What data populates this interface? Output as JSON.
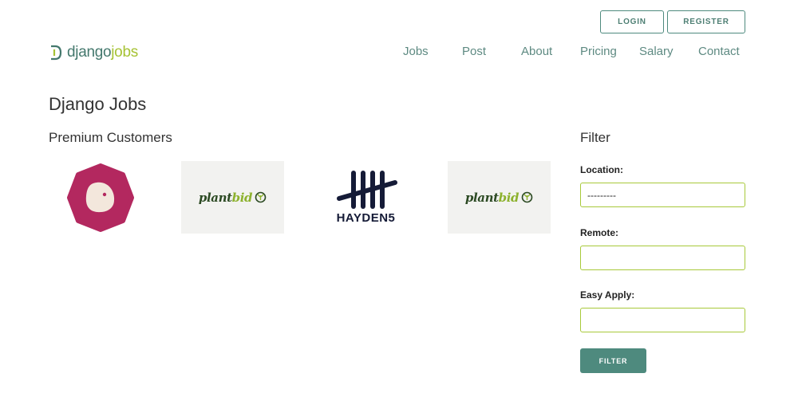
{
  "header": {
    "logo": {
      "part1": "django",
      "part2": "jobs"
    },
    "auth": {
      "login": "LOGIN",
      "register": "REGISTER"
    },
    "nav": [
      "Jobs",
      "Post",
      "About",
      "Pricing",
      "Salary",
      "Contact"
    ]
  },
  "main": {
    "title": "Django Jobs",
    "premium": {
      "heading": "Premium Customers",
      "customers": [
        {
          "name": "octagon-logo",
          "icon": "pink-octagon-blob"
        },
        {
          "name": "plantbid",
          "wordmark_1": "plant",
          "wordmark_2": "bid"
        },
        {
          "name": "hayden5",
          "wordmark": "HAYDEN5"
        },
        {
          "name": "plantbid",
          "wordmark_1": "plant",
          "wordmark_2": "bid"
        }
      ]
    }
  },
  "filter": {
    "title": "Filter",
    "location": {
      "label": "Location:",
      "value": "---------"
    },
    "remote": {
      "label": "Remote:",
      "value": ""
    },
    "easy_apply": {
      "label": "Easy Apply:",
      "value": ""
    },
    "button": "FILTER"
  },
  "colors": {
    "brand_teal": "#4e8a7e",
    "brand_green": "#a6c234",
    "nav_text": "#5e8a82",
    "field_border": "#a8c93a",
    "logo_pink": "#b3285f",
    "hayden_navy": "#151b37"
  }
}
